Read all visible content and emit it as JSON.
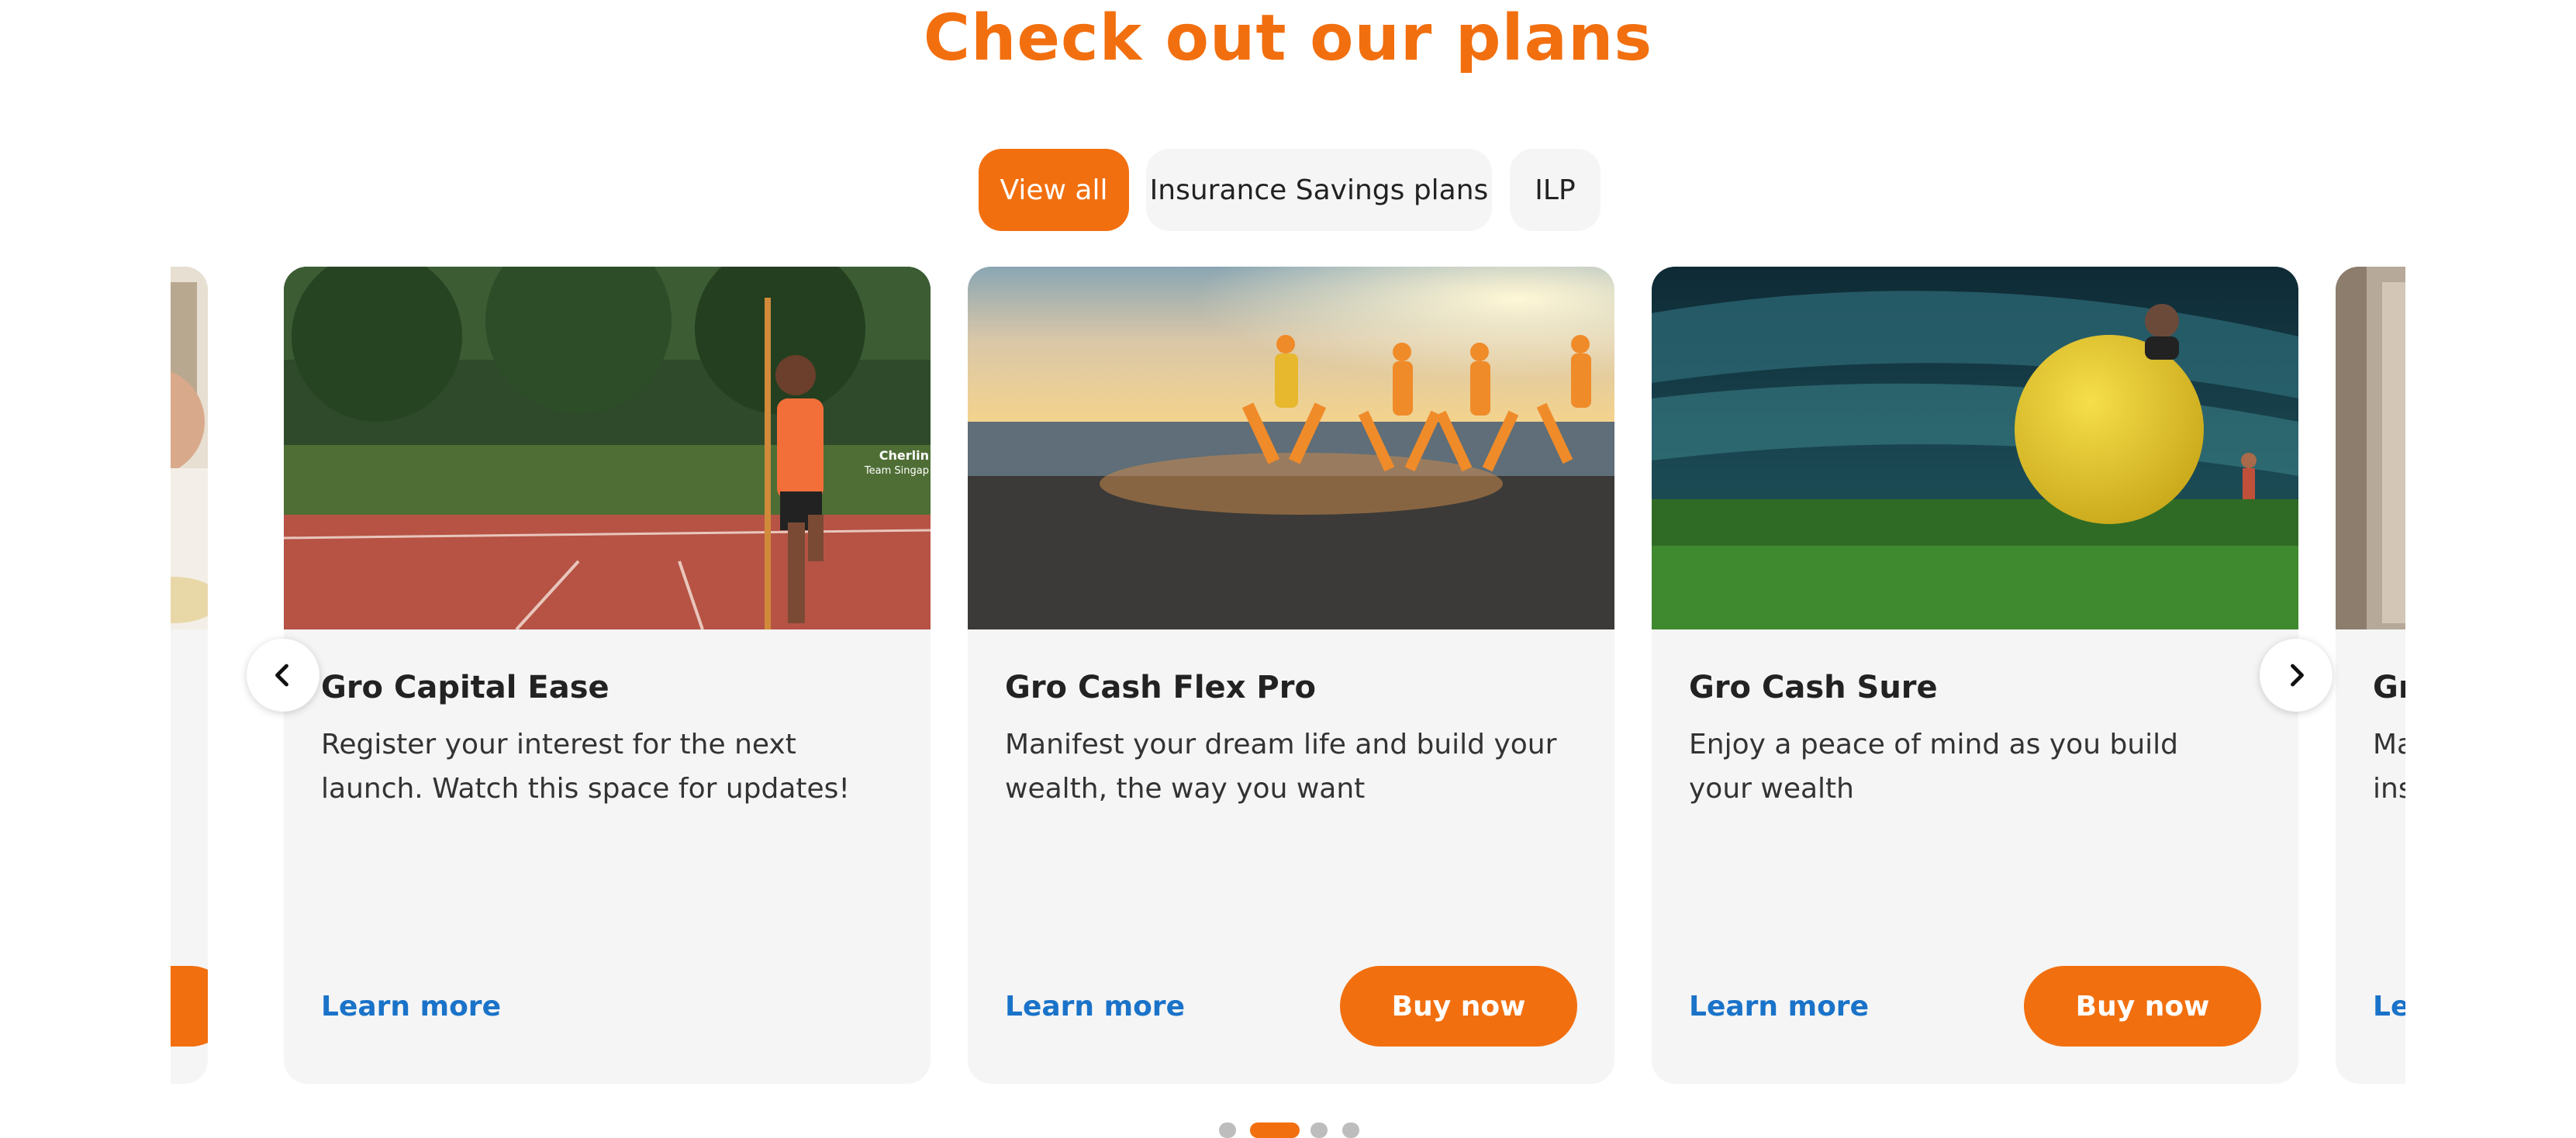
{
  "heading": "Check out our plans",
  "tabs": [
    {
      "label": "View all",
      "active": true
    },
    {
      "label": "Insurance Savings plans",
      "active": false
    },
    {
      "label": "ILP",
      "active": false
    }
  ],
  "cards": [
    {
      "title": "",
      "description": "",
      "learn_more": "",
      "buy_now": "",
      "image": "man-eating-photo"
    },
    {
      "title": "Gro Capital Ease",
      "description": "Register your interest for the next launch. Watch this space for updates!",
      "learn_more": "Learn more",
      "buy_now": "",
      "image": "athlete-on-track-photo",
      "image_caption_line1": "Cherlin",
      "image_caption_line2": "Team Singap"
    },
    {
      "title": "Gro Cash Flex Pro",
      "description": "Manifest your dream life and build your wealth, the way you want",
      "learn_more": "Learn more",
      "buy_now": "Buy now",
      "image": "yoga-by-sea-photo"
    },
    {
      "title": "Gro Cash Sure",
      "description": "Enjoy a peace of mind as you build your wealth",
      "learn_more": "Learn more",
      "buy_now": "Buy now",
      "image": "stadium-yellow-ball-photo"
    },
    {
      "title": "Gr",
      "description_line1": "Ma",
      "description_line2": "ins",
      "learn_more": "Le",
      "image": "interior-photo"
    }
  ],
  "carousel": {
    "prev_icon": "chevron-left-icon",
    "next_icon": "chevron-right-icon",
    "page_count": 4,
    "current_page": 2
  },
  "colors": {
    "accent": "#f26f0f",
    "link": "#1a73c9",
    "card_bg": "#f5f5f5"
  }
}
